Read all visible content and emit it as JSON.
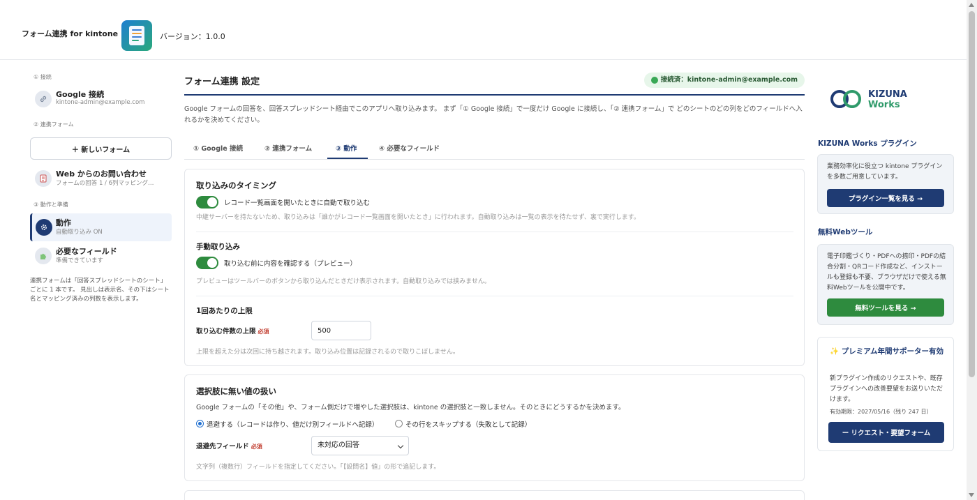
{
  "header": {
    "app_title": "フォーム連携 for kintone",
    "version": "バージョン：1.0.0"
  },
  "sidebar": {
    "section_connection": "① 接続",
    "google": {
      "title": "Google 接続",
      "subtitle": "kintone-admin@example.com"
    },
    "section_forms": "② 連携フォーム",
    "new_form_button": "＋ 新しいフォーム",
    "form_item": {
      "title": "Web からのお問い合わせ",
      "subtitle": "フォームの回答 1 / 6列マッピング…"
    },
    "section_behavior": "③ 動作と準備",
    "behavior_item": {
      "title": "動作",
      "subtitle": "自動取り込み ON"
    },
    "fields_item": {
      "title": "必要なフィールド",
      "subtitle": "準備できています"
    },
    "note": "連携フォームは「回答スプレッドシートのシート」ごとに 1 本です。 見出しは表示名、その下はシート名とマッピング済みの列数を表示します。"
  },
  "main": {
    "title": "フォーム連携 設定",
    "connection_badge": "接続済：kintone-admin@example.com",
    "intro": "Google フォームの回答を、回答スプレッドシート経由でこのアプリへ取り込みます。 まず「① Google 接続」で一度だけ Google に接続し、「② 連携フォーム」で どのシートのどの列をどのフィールドへ入れるかを決めてください。",
    "tabs": [
      {
        "label": "① Google 接続"
      },
      {
        "label": "② 連携フォーム"
      },
      {
        "label": "③ 動作"
      },
      {
        "label": "④ 必要なフィールド"
      }
    ],
    "active_tab": "③ 動作",
    "timing": {
      "heading": "取り込みのタイミング",
      "auto_toggle_label": "レコード一覧画面を開いたときに自動で取り込む",
      "auto_toggle_on": true,
      "auto_help": "中継サーバーを持たないため、取り込みは「誰かがレコード一覧画面を開いたとき」に行われます。自動取り込みは一覧の表示を待たせず、裏で実行します。",
      "manual_heading": "手動取り込み",
      "preview_toggle_label": "取り込む前に内容を確認する（プレビュー）",
      "preview_toggle_on": true,
      "preview_help": "プレビューはツールバーのボタンから取り込んだときだけ表示されます。自動取り込みでは挟みません。",
      "limit_heading": "1回あたりの上限",
      "limit_label": "取り込む件数の上限",
      "required": "必須",
      "limit_value": "500",
      "limit_help": "上限を超えた分は次回に持ち越されます。取り込み位置は記録されるので取りこぼしません。"
    },
    "choices": {
      "heading": "選択肢に無い値の扱い",
      "desc": "Google フォームの「その他」や、フォーム側だけで増やした選択肢は、kintone の選択肢と一致しません。そのときにどうするかを決めます。",
      "option_save": "退避する（レコードは作り、値だけ別フィールドへ記録）",
      "option_skip": "その行をスキップする（失敗として記録）",
      "selected": "save",
      "field_label": "退避先フィールド",
      "required": "必須",
      "field_value": "未対応の回答",
      "field_help": "文字列（複数行）フィールドを指定してください。「【設問名】値」の形で追記します。"
    }
  },
  "right": {
    "logo_line1": "KIZUNA",
    "logo_line2": "Works",
    "plugins_heading": "KIZUNA Works プラグイン",
    "plugins_text": "業務効率化に役立つ kintone プラグインを多数ご用意しています。",
    "plugins_button": "プラグイン一覧を見る →",
    "tools_heading": "無料Webツール",
    "tools_text": "電子印鑑づくり・PDFへの捺印・PDFの結合分割・QRコード作成など、インストールも登録も不要、ブラウザだけで使える無料Webツールを公開中です。",
    "tools_button": "無料ツールを見る →",
    "premium_title": "プレミアム年間サポーター有効",
    "premium_desc": "新プラグイン作成のリクエストや、既存プラグインへの改善要望をお送りいただけます。",
    "premium_expiry": "有効期限：2027/05/16（残り 247 日）",
    "premium_button": "ー リクエスト・要望フォーム"
  },
  "colors": {
    "navy": "#1f3b73",
    "green": "#2e8b3e",
    "badge_bg": "#e7f6ea",
    "required": "#c0392b"
  }
}
